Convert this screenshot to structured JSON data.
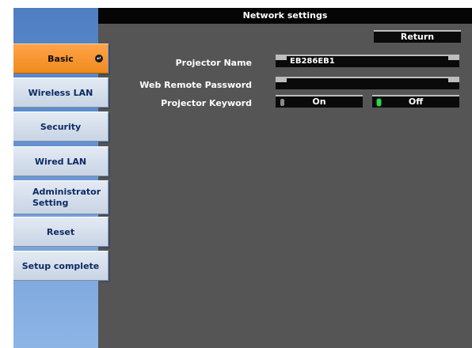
{
  "window": {
    "title": "Network settings"
  },
  "sidebar": {
    "items": [
      {
        "label": "Basic",
        "active": true
      },
      {
        "label": "Wireless LAN"
      },
      {
        "label": "Security"
      },
      {
        "label": "Wired LAN"
      },
      {
        "label": "Administrator Setting"
      },
      {
        "label": "Reset"
      },
      {
        "label": "Setup complete"
      }
    ]
  },
  "toolbar": {
    "return_label": "Return"
  },
  "form": {
    "projector_name": {
      "label": "Projector Name",
      "value": "EB286EB1"
    },
    "web_remote_password": {
      "label": "Web Remote Password",
      "value": ""
    },
    "projector_keyword": {
      "label": "Projector Keyword",
      "options": [
        "On",
        "Off"
      ],
      "selected": "Off"
    }
  },
  "colors": {
    "accent": "#f08a1c",
    "selected_indicator": "#2ed84a",
    "panel": "#555555",
    "titlebar": "#050505"
  },
  "icons": {
    "active_item": "enter-arrow-icon"
  }
}
